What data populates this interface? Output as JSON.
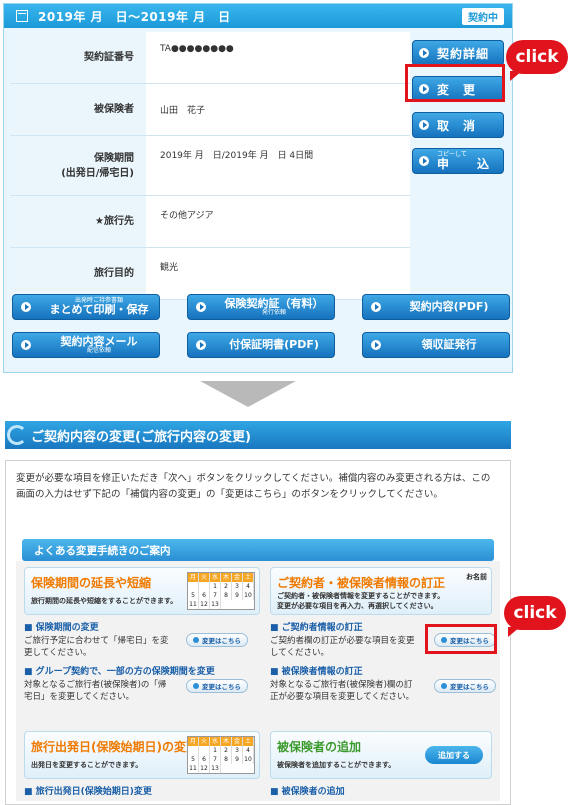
{
  "top": {
    "period": "2019年 月　日～2019年 月　日",
    "status": "契約中",
    "rows": [
      {
        "label": "契約証番号",
        "value": "TA●●●●●●●●"
      },
      {
        "label": "被保険者",
        "value": "山田　花子"
      },
      {
        "label": "保険期間\n(出発日/帰宅日)",
        "value": "2019年 月　日/2019年 月　日 4日間"
      },
      {
        "label": "★旅行先",
        "value": "その他アジア"
      },
      {
        "label": "旅行目的",
        "value": "観光"
      }
    ],
    "side_buttons": {
      "detail": "契約詳細",
      "change": "変　更",
      "cancel": "取　消",
      "apply_small": "コピーして",
      "apply_big": "申　込"
    },
    "bottom_buttons": {
      "print_sub": "出発時ご持参書類",
      "print_main": "まとめて印刷・保存",
      "cert_main": "保険契約証（有料）",
      "cert_sub": "発行依頼",
      "pdf": "契約内容(PDF)",
      "mail_main": "契約内容メール",
      "mail_sub": "配信依頼",
      "add_pdf": "付保証明書(PDF)",
      "receipt": "領収証発行"
    }
  },
  "click_label": "click",
  "section": {
    "title": "ご契約内容の変更(ご旅行内容の変更)",
    "intro": "変更が必要な項目を修正いただき「次へ」ボタンをクリックしてください。補償内容のみ変更される方は、この画面の入力はせず下記の「補償内容の変更」の「変更はこちら」のボタンをクリックしてください。",
    "faq_title": "よくある変更手続きのご案内",
    "banners": {
      "extend_title": "保険期間の延長や短縮",
      "extend_sub": "旅行期間の延長や短縮をすることができます。",
      "contractor_title": "ご契約者・被保険者情報の訂正",
      "contractor_sub1": "ご契約者・被保険者情報を変更することができます。",
      "contractor_sub2": "変更が必要な項目を再入力、再選択してください。",
      "contractor_tag": "お名前",
      "depart_title": "旅行出発日(保険始期日)の変更",
      "depart_sub": "出発日を変更することができます。",
      "add_title": "被保険者の追加",
      "add_sub": "被保険者を追加することができます。",
      "add_btn": "追加する"
    },
    "calendar": [
      "月",
      "火",
      "水",
      "木",
      "金",
      "土",
      "",
      "",
      "1",
      "2",
      "3",
      "4",
      "5",
      "6",
      "7",
      "8",
      "9",
      "10",
      "11",
      "12",
      "13"
    ],
    "items": {
      "period_change": "■ 保険期間の変更",
      "period_desc": "ご旅行予定に合わせて「帰宅日」を変更してください。",
      "contractor_fix": "■ ご契約者情報の訂正",
      "contractor_desc": "ご契約者欄の訂正が必要な項目を変更してください。",
      "group_change": "■ グループ契約で、一部の方の保険期間を変更",
      "group_desc": "対象となるご旅行者(被保険者)の「帰宅日」を変更してください。",
      "insured_fix": "■ 被保険者情報の訂正",
      "insured_desc": "対象となるご旅行者(被保険者)欄の訂正が必要な項目を変更してください。",
      "depart_change": "■ 旅行出発日(保険始期日)変更",
      "insured_add": "■ 被保険者の追加"
    },
    "change_btn": "変更はこちら"
  }
}
